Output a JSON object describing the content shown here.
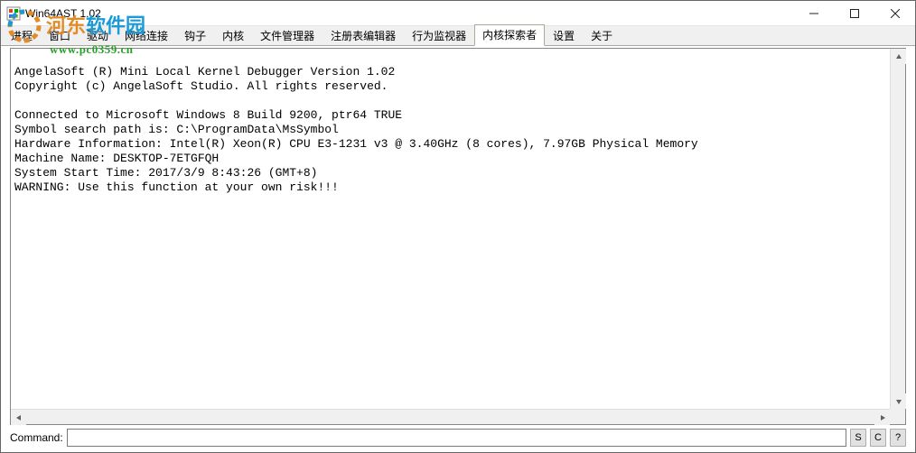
{
  "window": {
    "title": "Win64AST 1.02"
  },
  "tabs": [
    {
      "label": "进程",
      "active": false
    },
    {
      "label": "窗口",
      "active": false
    },
    {
      "label": "驱动",
      "active": false
    },
    {
      "label": "网络连接",
      "active": false
    },
    {
      "label": "钩子",
      "active": false
    },
    {
      "label": "内核",
      "active": false
    },
    {
      "label": "文件管理器",
      "active": false
    },
    {
      "label": "注册表编辑器",
      "active": false
    },
    {
      "label": "行为监视器",
      "active": false
    },
    {
      "label": "内核探索者",
      "active": true
    },
    {
      "label": "设置",
      "active": false
    },
    {
      "label": "关于",
      "active": false
    }
  ],
  "console": {
    "lines": [
      "",
      "AngelaSoft (R) Mini Local Kernel Debugger Version 1.02",
      "Copyright (c) AngelaSoft Studio. All rights reserved.",
      "",
      "Connected to Microsoft Windows 8 Build 9200, ptr64 TRUE",
      "Symbol search path is: C:\\ProgramData\\MsSymbol",
      "Hardware Information: Intel(R) Xeon(R) CPU E3-1231 v3 @ 3.40GHz (8 cores), 7.97GB Physical Memory",
      "Machine Name: DESKTOP-7ETGFQH",
      "System Start Time: 2017/3/9 8:43:26 (GMT+8)",
      "WARNING: Use this function at your own risk!!!"
    ]
  },
  "command": {
    "label": "Command:",
    "value": "",
    "buttons": {
      "s": "S",
      "c": "C",
      "question": "?"
    }
  },
  "watermark": {
    "text1": "河东",
    "text2": "软件园",
    "url": "www.pc0359.cn"
  }
}
